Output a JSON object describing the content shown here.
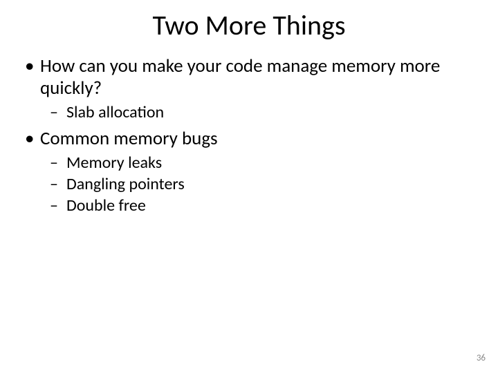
{
  "title": "Two More Things",
  "bullets": {
    "b1": "How can you make your code manage memory more quickly?",
    "b1_1": "Slab allocation",
    "b2": "Common memory bugs",
    "b2_1": "Memory leaks",
    "b2_2": "Dangling pointers",
    "b2_3": "Double free"
  },
  "page_number": "36"
}
